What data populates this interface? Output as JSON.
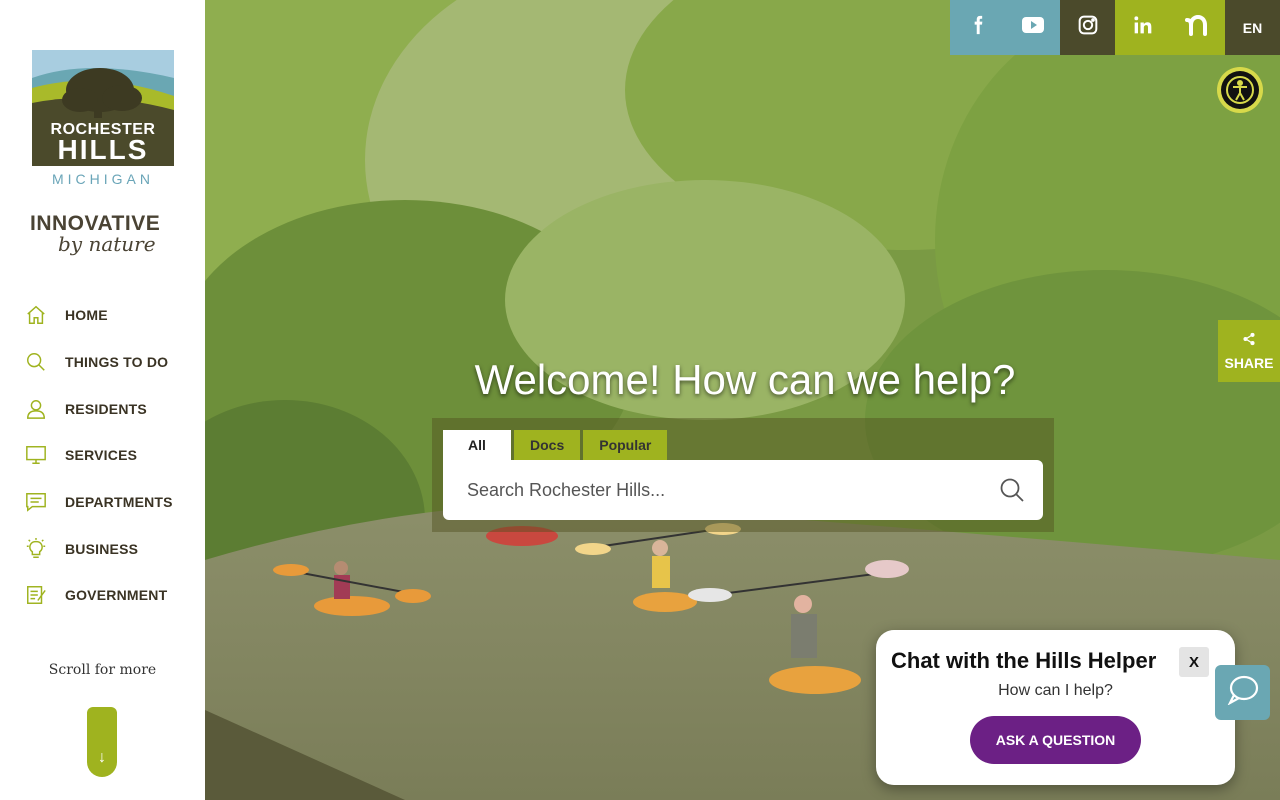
{
  "logo": {
    "line1": "ROCHESTER",
    "line2": "HILLS",
    "line3": "MICHIGAN"
  },
  "tagline": {
    "line1": "INNOVATIVE",
    "line2": "by nature"
  },
  "nav": {
    "items": [
      {
        "label": "HOME",
        "icon": "home-icon"
      },
      {
        "label": "THINGS TO DO",
        "icon": "search-icon"
      },
      {
        "label": "RESIDENTS",
        "icon": "person-icon"
      },
      {
        "label": "SERVICES",
        "icon": "monitor-icon"
      },
      {
        "label": "DEPARTMENTS",
        "icon": "chat-icon"
      },
      {
        "label": "BUSINESS",
        "icon": "lightbulb-icon"
      },
      {
        "label": "GOVERNMENT",
        "icon": "document-icon"
      }
    ]
  },
  "scroll": {
    "label": "Scroll for more",
    "arrow": "↓"
  },
  "social": {
    "language": "EN",
    "icons": [
      "facebook-icon",
      "youtube-icon",
      "instagram-icon",
      "linkedin-icon",
      "nextdoor-icon"
    ]
  },
  "share": {
    "label": "SHARE"
  },
  "hero": {
    "welcome": "Welcome! How can we help?"
  },
  "search": {
    "tabs": [
      "All",
      "Docs",
      "Popular"
    ],
    "active_tab": "All",
    "placeholder": "Search Rochester Hills..."
  },
  "chat": {
    "title": "Chat with the Hills Helper",
    "close": "X",
    "subtitle": "How can I help?",
    "button": "ASK A QUESTION"
  },
  "colors": {
    "green": "#9fb31f",
    "olive": "#4b4a2b",
    "teal": "#6aa7b3",
    "purple": "#6c2085"
  }
}
